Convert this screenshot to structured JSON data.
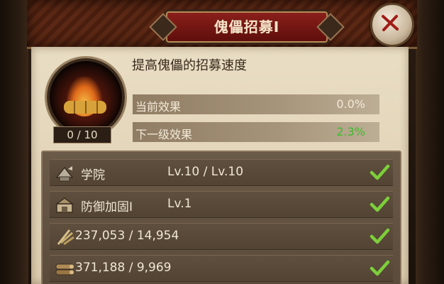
{
  "header": {
    "title": "傀儡招募I",
    "close_icon": "close-x-icon"
  },
  "upgrade": {
    "icon": "golem-recruit-icon",
    "progress": "0 / 10",
    "description": "提高傀儡的招募速度",
    "current_effect_label": "当前效果",
    "current_effect_value": "0.0%",
    "next_effect_label": "下一级效果",
    "next_effect_value": "2.3%",
    "next_effect_color": "#3cbd2a"
  },
  "requirements": [
    {
      "icon": "academy-icon",
      "name": "学院",
      "value": "Lv.10 / Lv.10",
      "met": true
    },
    {
      "icon": "defense-fortify-icon",
      "name": "防御加固I",
      "value": "Lv.1",
      "met": true
    },
    {
      "icon": "wheat-icon",
      "name": "",
      "value": "237,053 / 14,954",
      "met": true
    },
    {
      "icon": "wood-icon",
      "name": "",
      "value": "371,188 / 9,969",
      "met": true
    }
  ],
  "colors": {
    "check": "#7ccf3a",
    "title_plate": "#7a1a16",
    "parchment": "#e4d7bc"
  }
}
